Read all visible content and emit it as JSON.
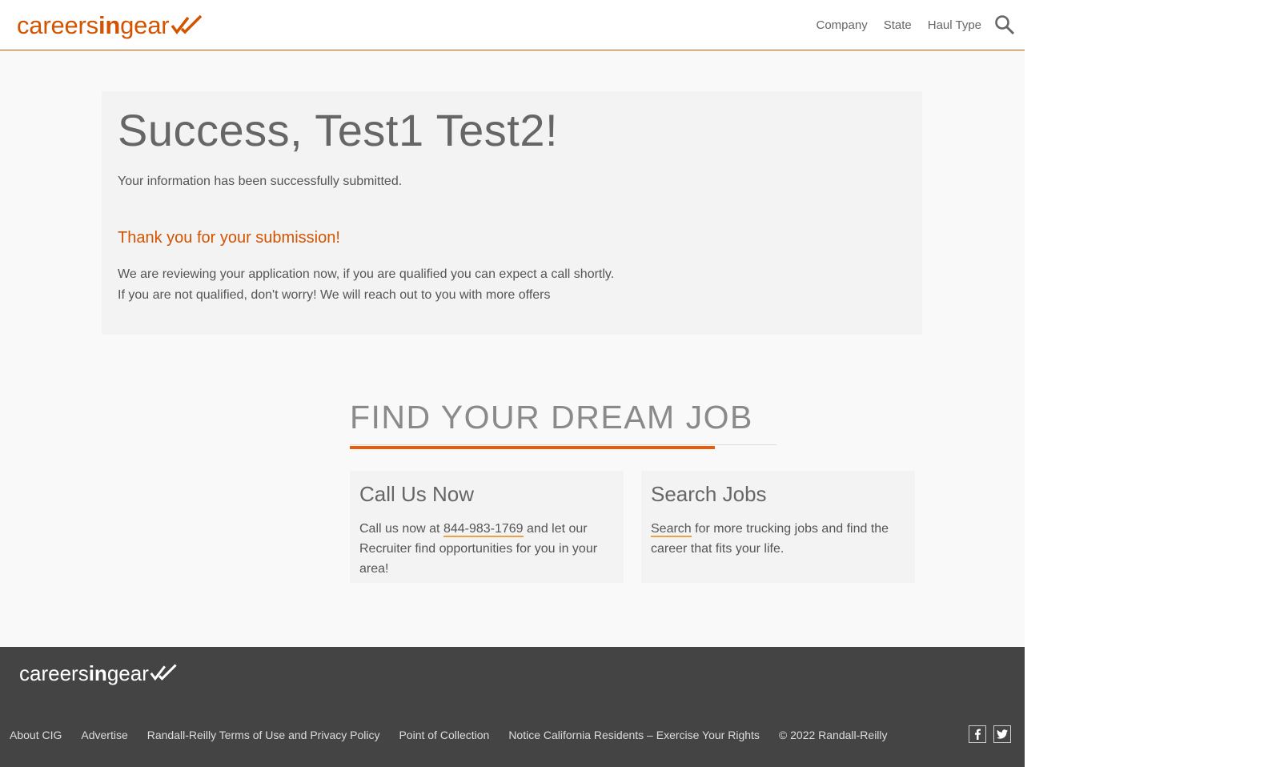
{
  "header": {
    "logo": {
      "prefix": "careers",
      "bold": "in",
      "suffix": "gear"
    },
    "nav": [
      {
        "label": "Company"
      },
      {
        "label": "State"
      },
      {
        "label": "Haul Type"
      }
    ]
  },
  "success": {
    "title": "Success, Test1 Test2!",
    "subtitle": "Your information has been successfully submitted.",
    "thanks": "Thank you for your submission!",
    "message_line1": "We are reviewing your application now, if you are qualified you can expect a call shortly.",
    "message_line2": "If you are not qualified, don't worry! We will reach out to you with more offers"
  },
  "dream_job": {
    "heading": "FIND YOUR DREAM JOB",
    "call": {
      "title": "Call Us Now",
      "text_before": "Call us now at ",
      "phone": "844-983-1769",
      "text_after": " and let our Recruiter find opportunities for you in your area!"
    },
    "search": {
      "title": "Search Jobs",
      "link": "Search",
      "text_after": " for more trucking jobs and find the career that fits your life."
    }
  },
  "footer": {
    "logo": {
      "prefix": "careers",
      "bold": "in",
      "suffix": "gear"
    },
    "links": [
      {
        "label": "About CIG"
      },
      {
        "label": "Advertise"
      },
      {
        "label": "Randall-Reilly Terms of Use and Privacy Policy"
      },
      {
        "label": "Point of Collection"
      },
      {
        "label": "Notice California Residents – Exercise Your Rights"
      },
      {
        "label": "© 2022 Randall-Reilly"
      }
    ],
    "social": [
      {
        "icon": "facebook-icon"
      },
      {
        "icon": "twitter-icon"
      }
    ]
  },
  "colors": {
    "brand": "#d35400",
    "accent_line": "#e85d0c",
    "footer_bg": "#444444"
  }
}
